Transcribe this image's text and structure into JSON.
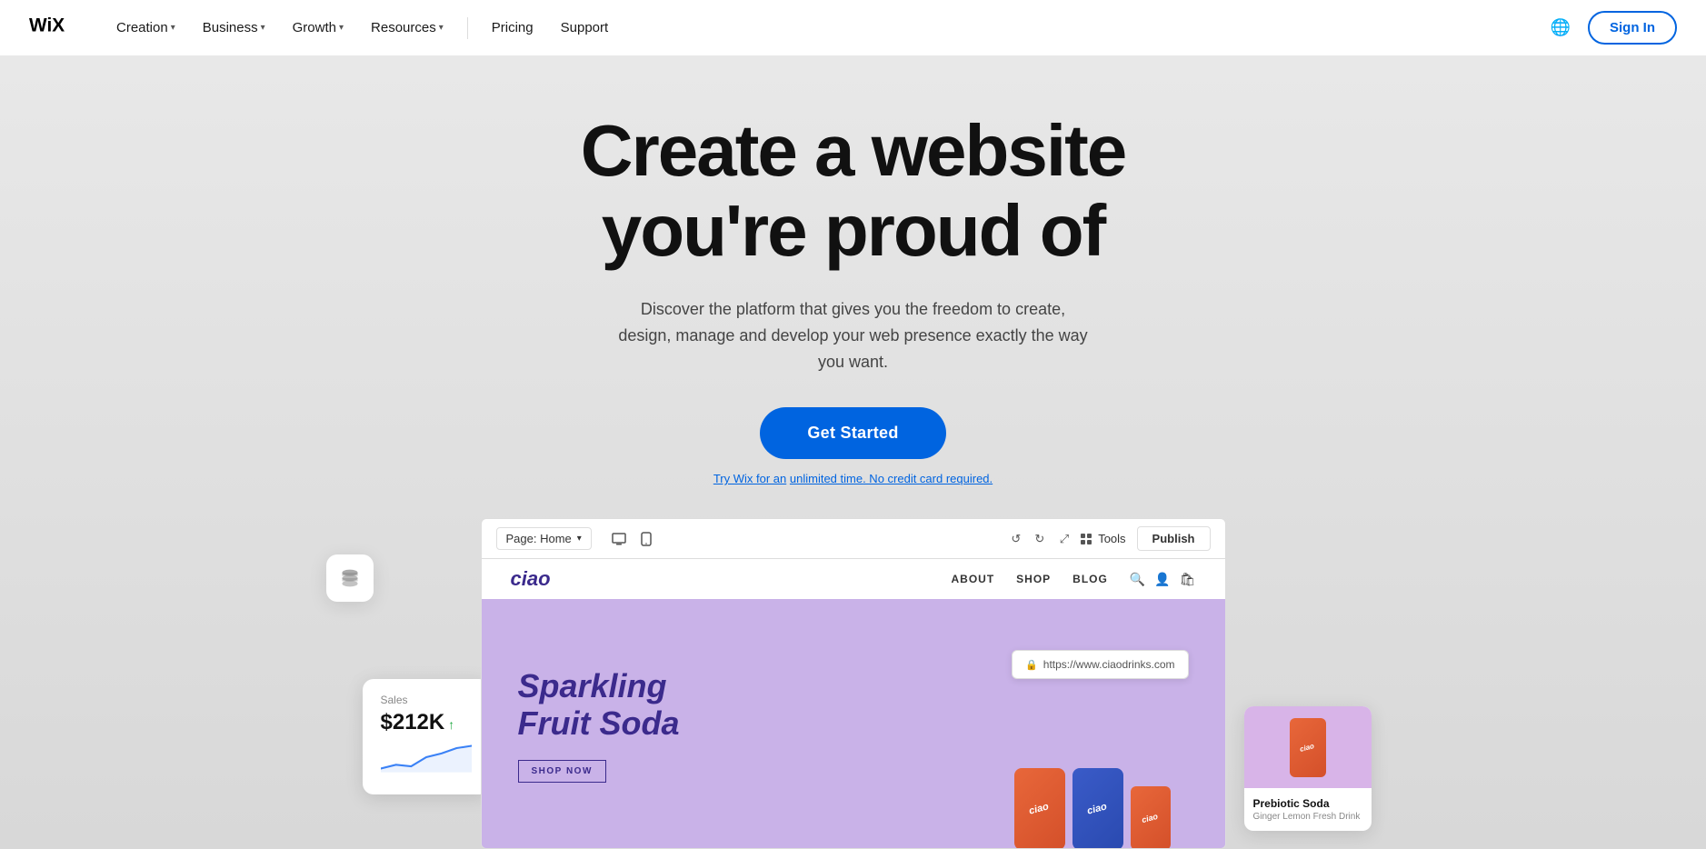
{
  "navbar": {
    "logo": "Wix",
    "nav_items": [
      {
        "label": "Creation",
        "has_dropdown": true
      },
      {
        "label": "Business",
        "has_dropdown": true
      },
      {
        "label": "Growth",
        "has_dropdown": true
      },
      {
        "label": "Resources",
        "has_dropdown": true
      }
    ],
    "plain_links": [
      "Pricing",
      "Support"
    ],
    "globe_icon": "🌐",
    "signin_label": "Sign In"
  },
  "hero": {
    "title_line1": "Create a website",
    "title_line2": "you're proud of",
    "subtitle": "Discover the platform that gives you the freedom to create, design, manage and develop your web presence exactly the way you want.",
    "cta_button": "Get Started",
    "free_text_prefix": "Try Wix for an",
    "free_text_link": "unlimited time",
    "free_text_suffix": ". No credit card required."
  },
  "editor": {
    "page_selector_label": "Page: Home",
    "tools_label": "Tools",
    "publish_label": "Publish",
    "url": "https://www.ciaodrinks.com"
  },
  "mockup_site": {
    "logo": "ciao",
    "nav_links": [
      "ABOUT",
      "SHOP",
      "BLOG"
    ],
    "headline_line1": "Sparkling",
    "headline_line2": "Fruit Soda",
    "shop_now_label": "SHOP NOW",
    "can_label": "ciao"
  },
  "sales_widget": {
    "label": "Sales",
    "amount": "$212K",
    "trend": "↑"
  },
  "product_card": {
    "name": "Prebiotic Soda",
    "description": "Ginger Lemon Fresh Drink"
  }
}
